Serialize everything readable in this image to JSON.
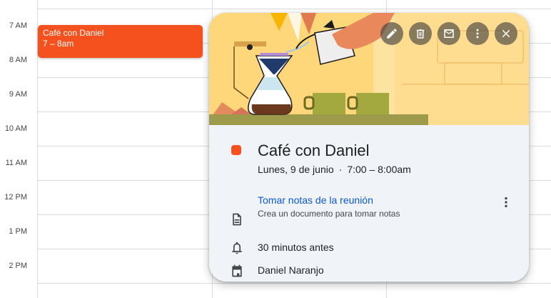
{
  "calendar": {
    "hours": [
      "7 AM",
      "8 AM",
      "9 AM",
      "10 AM",
      "11 AM",
      "12 PM",
      "1 PM",
      "2 PM"
    ]
  },
  "event_chip": {
    "title": "Café con Daniel",
    "time": "7 – 8am",
    "color": "#f4511e"
  },
  "popup": {
    "actions": [
      {
        "name": "edit-button",
        "icon": "pencil-icon"
      },
      {
        "name": "delete-button",
        "icon": "trash-icon"
      },
      {
        "name": "email-button",
        "icon": "mail-icon"
      },
      {
        "name": "options-button",
        "icon": "more-vert-icon"
      },
      {
        "name": "close-button",
        "icon": "close-icon"
      }
    ],
    "title": "Café con Daniel",
    "date": "Lunes, 9 de junio",
    "separator": "·",
    "time_range": "7:00 – 8:00am",
    "notes_link": "Tomar notas de la reunión",
    "notes_sub": "Crea un documento para tomar notas",
    "reminder": "30 minutos antes",
    "organizer": "Daniel Naranjo",
    "event_color": "#f4511e",
    "accent_link_color": "#0b57d0"
  }
}
